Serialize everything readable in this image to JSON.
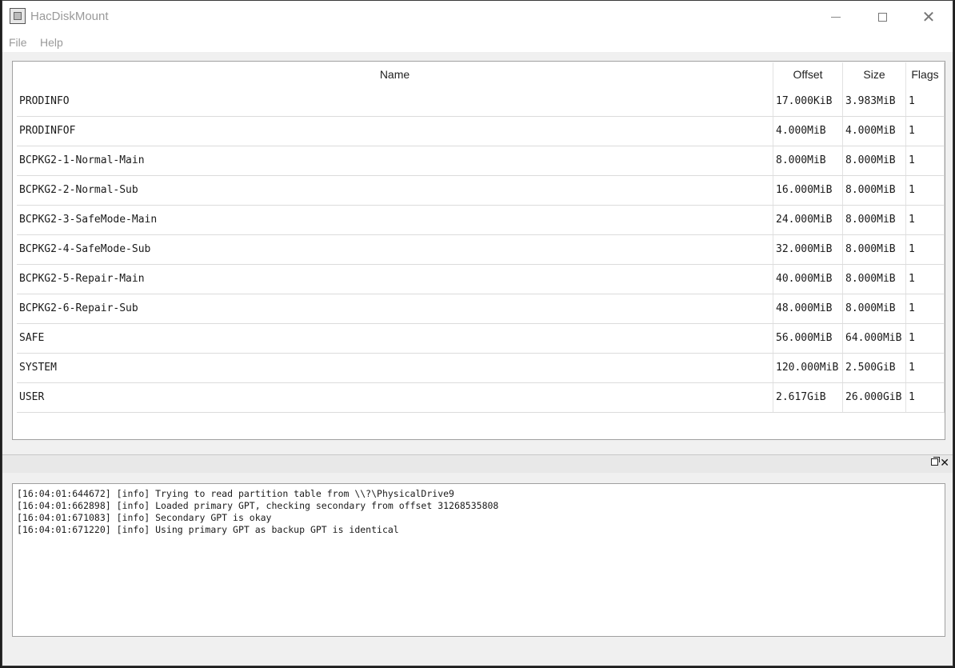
{
  "window": {
    "title": "HacDiskMount"
  },
  "menu": {
    "file": "File",
    "help": "Help"
  },
  "table": {
    "headers": {
      "name": "Name",
      "offset": "Offset",
      "size": "Size",
      "flags": "Flags"
    },
    "rows": [
      {
        "name": "PRODINFO",
        "offset": "17.000KiB",
        "size": "3.983MiB",
        "flags": "1"
      },
      {
        "name": "PRODINFOF",
        "offset": "4.000MiB",
        "size": "4.000MiB",
        "flags": "1"
      },
      {
        "name": "BCPKG2-1-Normal-Main",
        "offset": "8.000MiB",
        "size": "8.000MiB",
        "flags": "1"
      },
      {
        "name": "BCPKG2-2-Normal-Sub",
        "offset": "16.000MiB",
        "size": "8.000MiB",
        "flags": "1"
      },
      {
        "name": "BCPKG2-3-SafeMode-Main",
        "offset": "24.000MiB",
        "size": "8.000MiB",
        "flags": "1"
      },
      {
        "name": "BCPKG2-4-SafeMode-Sub",
        "offset": "32.000MiB",
        "size": "8.000MiB",
        "flags": "1"
      },
      {
        "name": "BCPKG2-5-Repair-Main",
        "offset": "40.000MiB",
        "size": "8.000MiB",
        "flags": "1"
      },
      {
        "name": "BCPKG2-6-Repair-Sub",
        "offset": "48.000MiB",
        "size": "8.000MiB",
        "flags": "1"
      },
      {
        "name": "SAFE",
        "offset": "56.000MiB",
        "size": "64.000MiB",
        "flags": "1"
      },
      {
        "name": "SYSTEM",
        "offset": "120.000MiB",
        "size": "2.500GiB",
        "flags": "1"
      },
      {
        "name": "USER",
        "offset": "2.617GiB",
        "size": "26.000GiB",
        "flags": "1"
      }
    ]
  },
  "log": {
    "lines": [
      "[16:04:01:644672] [info] Trying to read partition table from \\\\?\\PhysicalDrive9",
      "[16:04:01:662898] [info] Loaded primary GPT, checking secondary from offset 31268535808",
      "[16:04:01:671083] [info] Secondary GPT is okay",
      "[16:04:01:671220] [info] Using primary GPT as backup GPT is identical"
    ]
  },
  "icons": {
    "app": "app-icon",
    "minimize": "minimize-icon",
    "maximize": "maximize-icon",
    "close": "close-icon",
    "dock_float": "float-icon",
    "dock_close": "close-icon"
  }
}
